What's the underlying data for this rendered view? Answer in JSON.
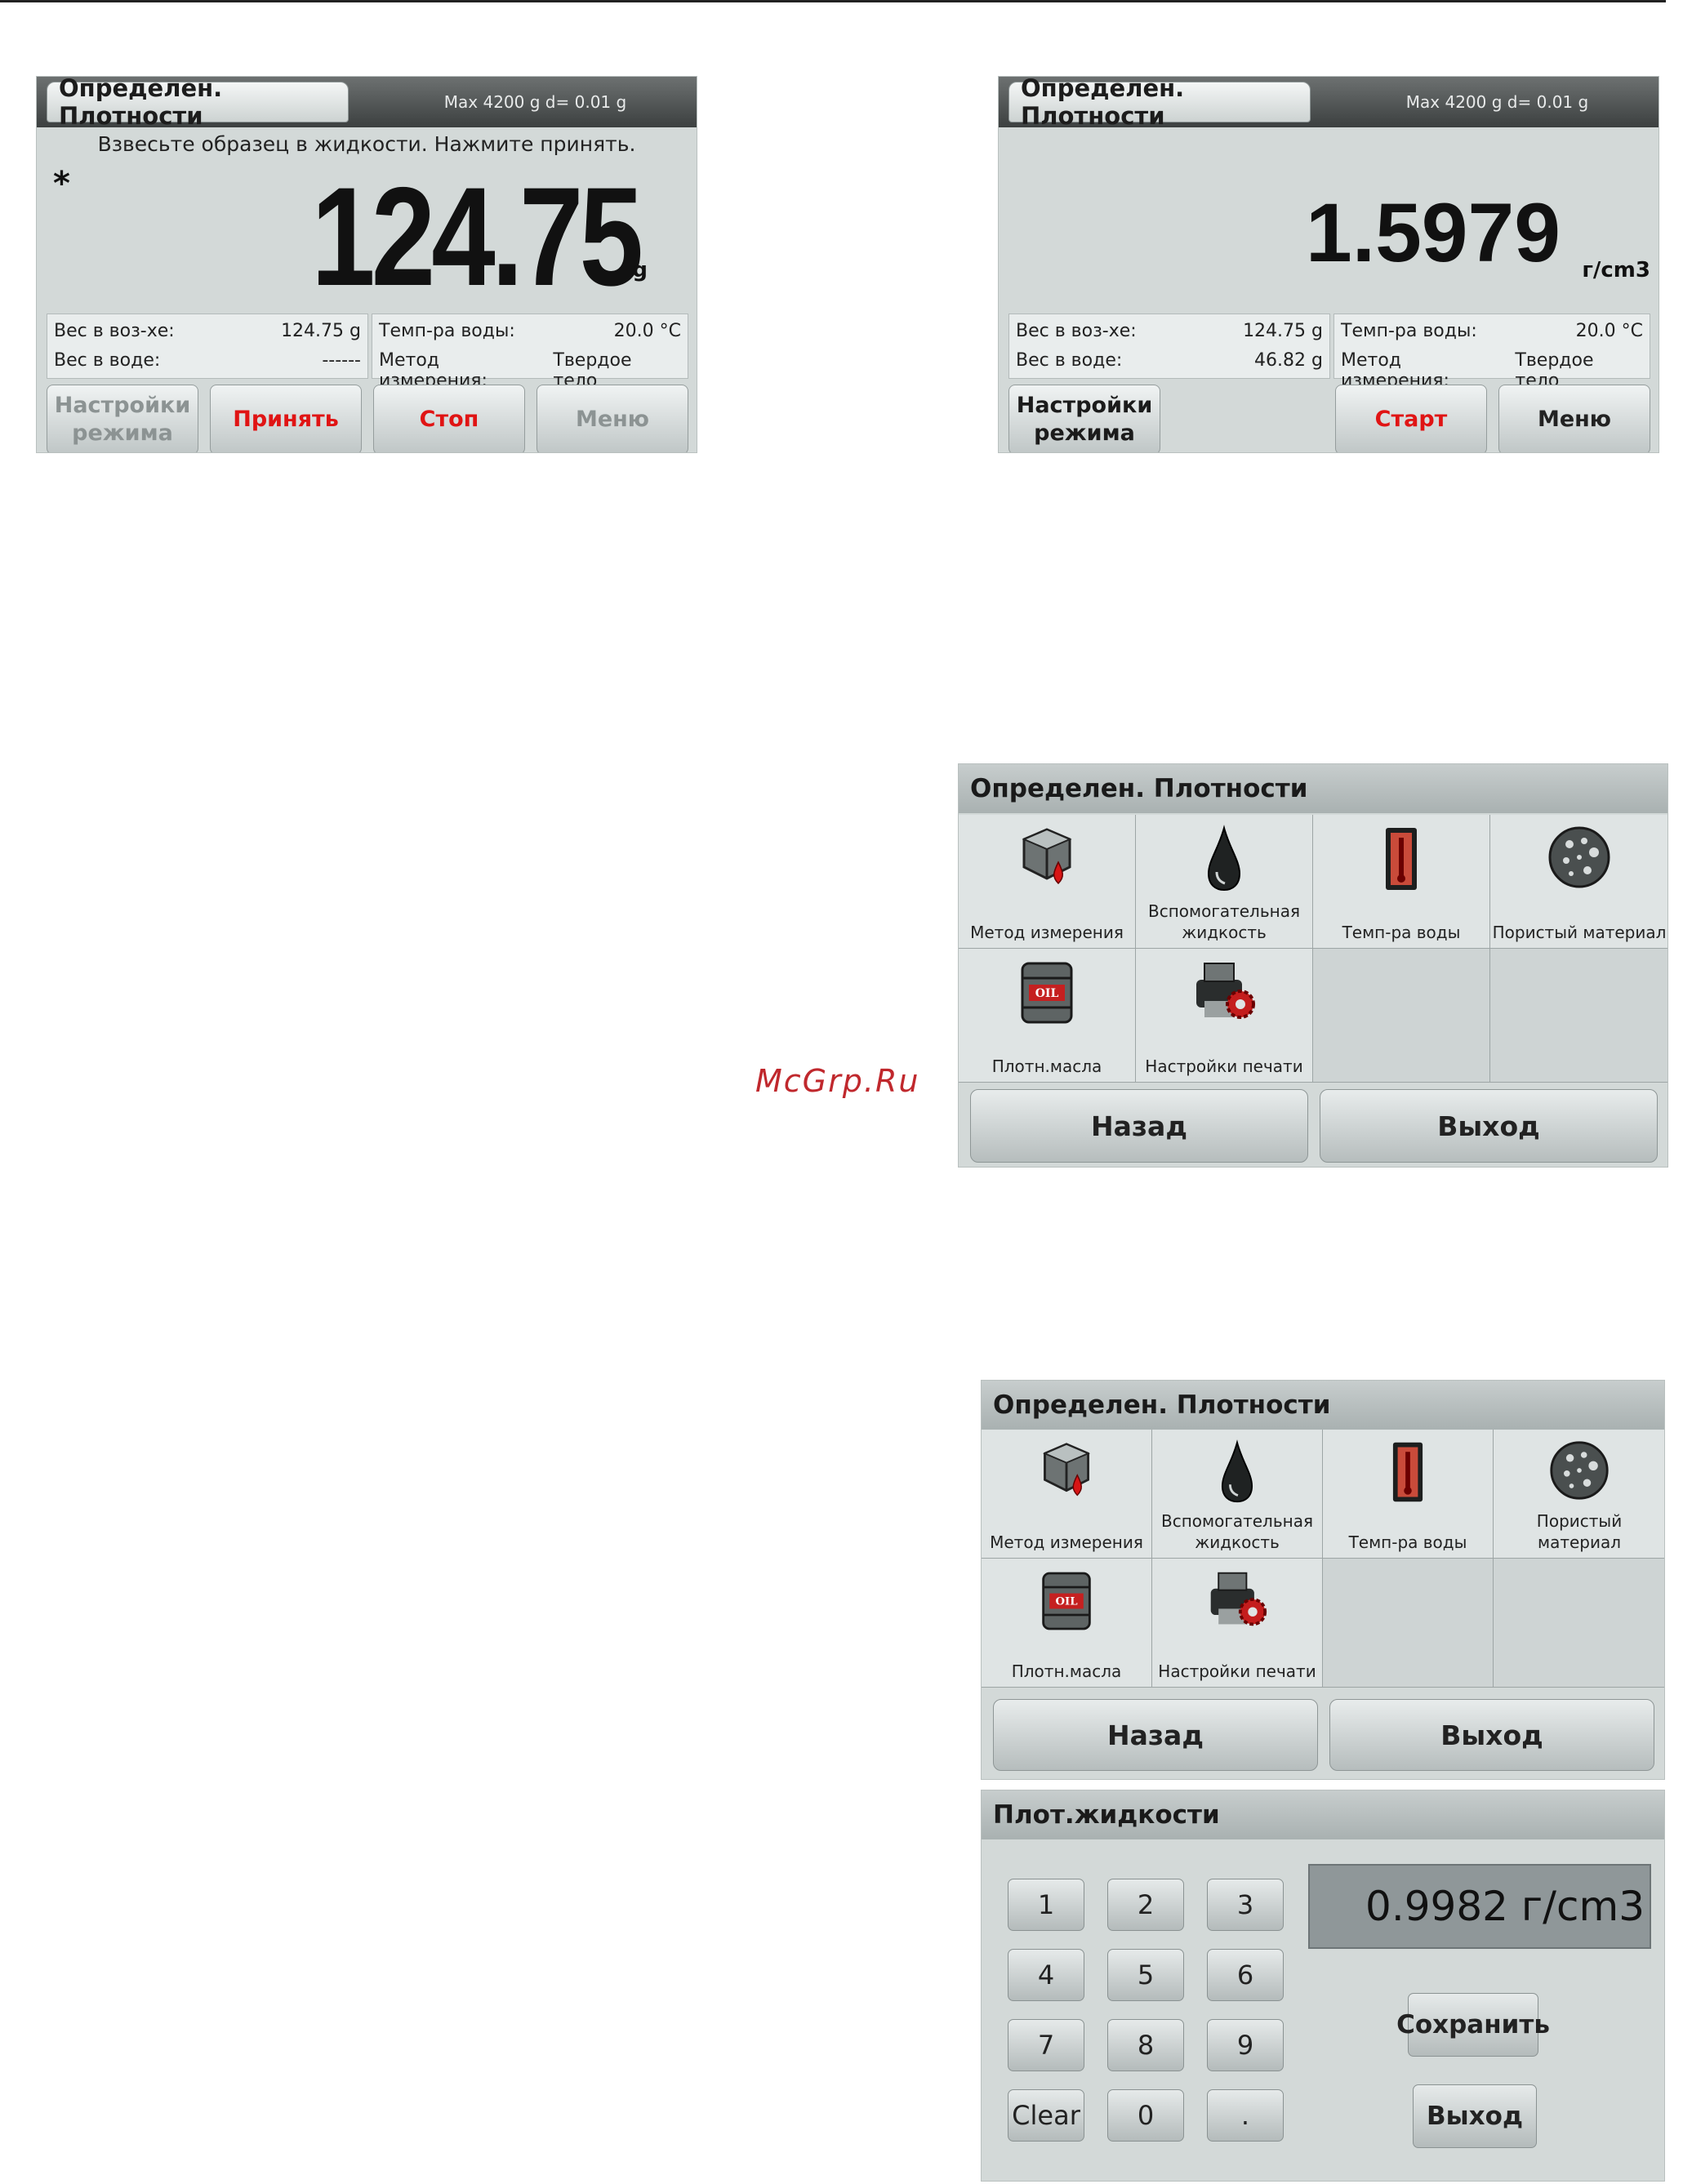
{
  "screen1": {
    "tab": "Определен. Плотности",
    "capacity": "Max 4200 g   d= 0.01 g",
    "message": "Взвесьте образец в жидкости. Нажмите принять.",
    "stable_indicator": "*",
    "reading": "124.75",
    "unit": "g",
    "weight_air_label": "Вес в воз-хе:",
    "weight_air_value": "124.75 g",
    "weight_water_label": "Вес в воде:",
    "weight_water_value": "------",
    "water_temp_label": "Темп-ра воды:",
    "water_temp_value": "20.0 °C",
    "method_label": "Метод измерения:",
    "method_value": "Твердое тело",
    "btn_settings": "Настройки режима",
    "btn_accept": "Принять",
    "btn_stop": "Стоп",
    "btn_menu": "Меню"
  },
  "screen2": {
    "tab": "Определен. Плотности",
    "capacity": "Max 4200 g   d= 0.01 g",
    "reading": "1.5979",
    "unit": "г/cm3",
    "weight_air_label": "Вес в воз-хе:",
    "weight_air_value": "124.75 g",
    "weight_water_label": "Вес в воде:",
    "weight_water_value": "46.82 g",
    "water_temp_label": "Темп-ра воды:",
    "water_temp_value": "20.0 °C",
    "method_label": "Метод измерения:",
    "method_value": "Твердое тело",
    "btn_settings": "Настройки режима",
    "btn_start": "Старт",
    "btn_menu": "Меню"
  },
  "menu": {
    "title": "Определен. Плотности",
    "items": [
      {
        "label": "Метод измерения",
        "icon": "cube-drop-icon"
      },
      {
        "label": "Вспомогательная жидкость",
        "icon": "drop-icon"
      },
      {
        "label": "Темп-ра воды",
        "icon": "thermometer-icon"
      },
      {
        "label": "Пористый материал",
        "icon": "porous-ball-icon"
      },
      {
        "label": "Плотн.масла",
        "icon": "oil-barrel-icon"
      },
      {
        "label": "Настройки печати",
        "icon": "printer-gear-icon"
      }
    ],
    "back": "Назад",
    "exit": "Выход"
  },
  "keypad": {
    "title": "Плот.жидкости",
    "display": "0.9982 г/cm3",
    "keys": [
      "1",
      "2",
      "3",
      "4",
      "5",
      "6",
      "7",
      "8",
      "9",
      "Clear",
      "0",
      "."
    ],
    "save": "Сохранить",
    "exit": "Выход"
  },
  "watermark": "McGrp.Ru"
}
